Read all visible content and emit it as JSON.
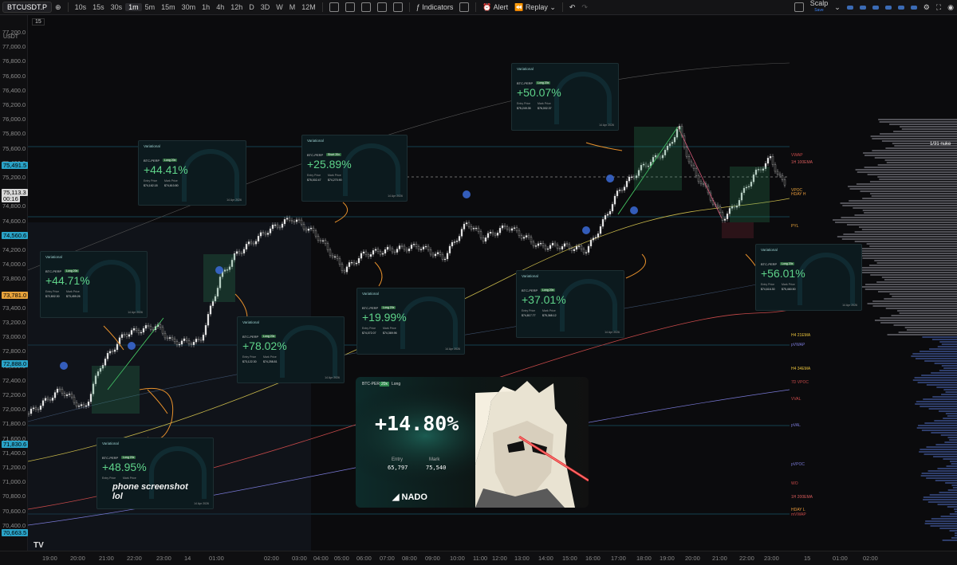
{
  "toolbar": {
    "symbol": "BTCUSDT.P",
    "timeframes": [
      "10s",
      "15s",
      "30s",
      "1m",
      "5m",
      "15m",
      "30m",
      "1h",
      "4h",
      "12h",
      "D",
      "3D",
      "W",
      "M",
      "12M"
    ],
    "active_timeframe": "1m",
    "indicators_label": "Indicators",
    "alert_label": "Alert",
    "replay_label": "Replay",
    "layout_label": "Scalp",
    "layout_sub": "Save"
  },
  "chart_header": {
    "currency": "USDT",
    "interval": "15"
  },
  "price_axis": {
    "labels": [
      "77,200.0",
      "77,000.0",
      "76,800.0",
      "76,600.0",
      "76,400.0",
      "76,200.0",
      "76,000.0",
      "75,800.0",
      "75,600.0",
      "75,400.0",
      "75,200.0",
      "75,000.0",
      "74,800.0",
      "74,600.0",
      "74,400.0",
      "74,200.0",
      "74,000.0",
      "73,800.0",
      "73,600.0",
      "73,400.0",
      "73,200.0",
      "73,000.0",
      "72,800.0",
      "72,600.0",
      "72,400.0",
      "72,200.0",
      "72,000.0",
      "71,800.0",
      "71,600.0",
      "71,400.0",
      "71,200.0",
      "71,000.0",
      "70,800.0",
      "70,600.0",
      "70,400.0"
    ],
    "highlights": [
      {
        "text": "75,491.5",
        "color": "#2aa3c8"
      },
      {
        "text": "75,113.3",
        "color": "#d8d8d8"
      },
      {
        "text": "00:16",
        "color": "#d8d8d8"
      },
      {
        "text": "74,560.6",
        "color": "#2aa3c8"
      },
      {
        "text": "73,781.0",
        "color": "#e8a33c"
      },
      {
        "text": "72,888.0",
        "color": "#2aa3c8"
      },
      {
        "text": "71,830.6",
        "color": "#2aa3c8"
      },
      {
        "text": "70,663.5",
        "color": "#2aa3c8"
      }
    ]
  },
  "time_axis": [
    "19:00",
    "20:00",
    "21:00",
    "22:00",
    "23:00",
    "14",
    "01:00",
    "02:00",
    "03:00",
    "04:00",
    "05:00",
    "06:00",
    "07:00",
    "08:00",
    "09:00",
    "10:00",
    "11:00",
    "12:00",
    "13:00",
    "14:00",
    "15:00",
    "16:00",
    "17:00",
    "18:00",
    "19:00",
    "20:00",
    "21:00",
    "22:00",
    "23:00",
    "15",
    "01:00",
    "02:00"
  ],
  "right_labels": [
    {
      "text": "1/31 nuke",
      "color": "#ffffff"
    },
    {
      "text": "VWAP",
      "color": "#c84a4a"
    },
    {
      "text": "1H 100EMA",
      "color": "#d85b5b"
    },
    {
      "text": "VPOC",
      "color": "#e8a33c"
    },
    {
      "text": "HDAY H",
      "color": "#e89a3c"
    },
    {
      "text": "PYL",
      "color": "#e8a33c"
    },
    {
      "text": "sVWAP",
      "color": "#c84a4a"
    },
    {
      "text": "H4 21EMA",
      "color": "#e8c23c"
    },
    {
      "text": "pVWAP",
      "color": "#7a7ad8"
    },
    {
      "text": "H4 34EMA",
      "color": "#e8c23c"
    },
    {
      "text": "7D VPOC",
      "color": "#c84a4a"
    },
    {
      "text": "VVAL",
      "color": "#c84a4a"
    },
    {
      "text": "pVAL",
      "color": "#7a7ad8"
    },
    {
      "text": "pVPOC",
      "color": "#7a7ad8"
    },
    {
      "text": "WO",
      "color": "#c84a4a"
    },
    {
      "text": "1H 200EMA",
      "color": "#d85b5b"
    },
    {
      "text": "HDAY L",
      "color": "#e89a3c"
    },
    {
      "text": "mVWAP",
      "color": "#c84a4a"
    }
  ],
  "cards": [
    {
      "brand": "Variational",
      "pair": "BTC-PERP",
      "tag": "Long 20x",
      "pct": "+44.41%",
      "entry": "$74,162.18",
      "mark": "$74,610.80",
      "date": "14 Apr 2026"
    },
    {
      "brand": "Variational",
      "pair": "BTC-PERP",
      "tag": "Short 20x",
      "pct": "+25.89%",
      "entry": "$75,002.47",
      "mark": "$74,270.90",
      "date": "14 Apr 2026"
    },
    {
      "brand": "Variational",
      "pair": "BTC-PERP",
      "tag": "Long 20x",
      "pct": "+50.07%",
      "entry": "$75,249.35",
      "mark": "$76,002.37",
      "date": "14 Apr 2026"
    },
    {
      "brand": "Variational",
      "pair": "BTC-PERP",
      "tag": "Long 20x",
      "pct": "+44.71%",
      "entry": "$72,802.30",
      "mark": "$73,459.26",
      "date": "14 Apr 2026"
    },
    {
      "brand": "Variational",
      "pair": "BTC-PERP",
      "tag": "Long 20x",
      "pct": "+78.02%",
      "entry": "$73,122.30",
      "mark": "$74,258.81",
      "date": "14 Apr 2026"
    },
    {
      "brand": "Variational",
      "pair": "BTC-PERP",
      "tag": "Long 20x",
      "pct": "+19.99%",
      "entry": "$74,072.07",
      "mark": "$74,369.96",
      "date": "14 Apr 2026"
    },
    {
      "brand": "Variational",
      "pair": "BTC-PERP",
      "tag": "Long 20x",
      "pct": "+37.01%",
      "entry": "$74,817.77",
      "mark": "$75,368.12",
      "date": "14 Apr 2026"
    },
    {
      "brand": "Variational",
      "pair": "BTC-PERP",
      "tag": "Long 20x",
      "pct": "+56.01%",
      "entry": "$74,616.30",
      "mark": "$75,460.50",
      "date": "14 Apr 2026"
    },
    {
      "brand": "Variational",
      "pair": "BTC-PERP",
      "tag": "Long 20x",
      "pct": "+48.95%",
      "entry": "",
      "mark": "",
      "date": "14 Apr 2026"
    }
  ],
  "card_labels": {
    "entry": "Entry Price",
    "mark": "Mark Price"
  },
  "nado": {
    "pair": "BTC-PERP",
    "tag": "20x",
    "side": "Long",
    "pct": "+14.80%",
    "entry_label": "Entry",
    "entry": "65,797",
    "mark_label": "Mark",
    "mark": "75,540",
    "logo": "NADO"
  },
  "annotation": {
    "line1": "phone screenshot",
    "line2": "lol"
  },
  "colors": {
    "bull": "#26a69a",
    "bear": "#ef5350",
    "accent": "#2aa3c8",
    "orange": "#e8912c"
  }
}
